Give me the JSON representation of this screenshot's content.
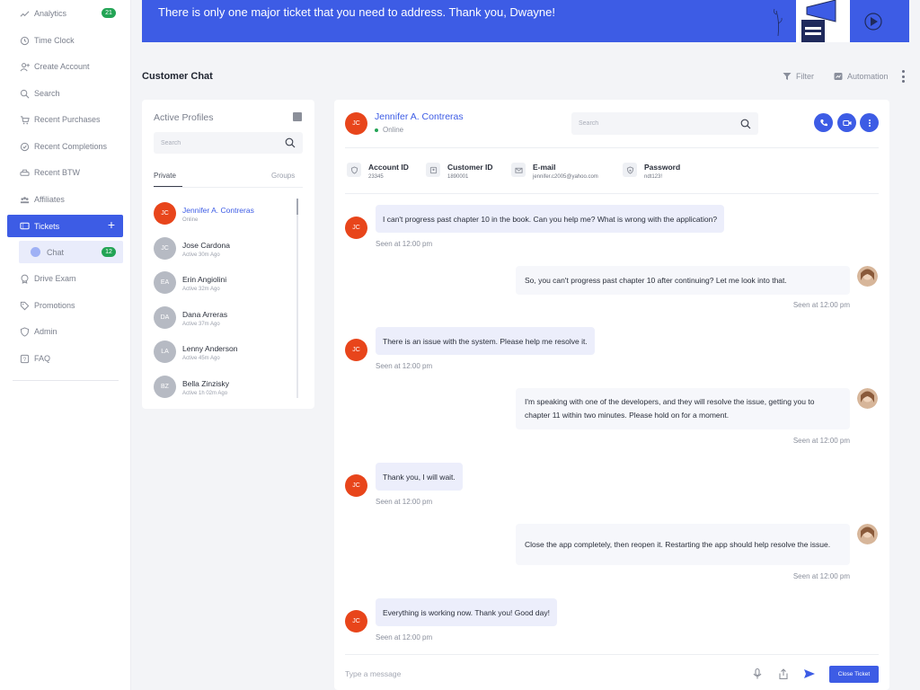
{
  "sidebar": {
    "items": [
      {
        "label": "Analytics",
        "badge": "21",
        "icon": "chart-line-icon"
      },
      {
        "label": "Time Clock",
        "icon": "clock-icon"
      },
      {
        "label": "Create Account",
        "icon": "add-user-icon"
      },
      {
        "label": "Search",
        "icon": "search-icon"
      },
      {
        "label": "Recent Purchases",
        "icon": "cart-icon"
      },
      {
        "label": "Recent Completions",
        "icon": "check-circle-icon"
      },
      {
        "label": "Recent BTW",
        "icon": "car-icon"
      },
      {
        "label": "Affiliates",
        "icon": "people-icon"
      },
      {
        "label": "Tickets",
        "icon": "ticket-icon",
        "active": true
      },
      {
        "label": "Drive Exam",
        "icon": "badge-icon"
      },
      {
        "label": "Promotions",
        "icon": "tag-icon"
      },
      {
        "label": "Admin",
        "icon": "shield-icon"
      },
      {
        "label": "FAQ",
        "icon": "question-icon"
      }
    ],
    "sub_item": {
      "label": "Chat",
      "badge": "12"
    }
  },
  "banner": {
    "text": "There is only one major ticket that you need to address. Thank you, Dwayne!"
  },
  "header": {
    "title": "Customer Chat",
    "filter_label": "Filter",
    "automation_label": "Automation"
  },
  "profiles": {
    "title": "Active Profiles",
    "search_placeholder": "Search",
    "tabs": [
      "Private",
      "Groups"
    ],
    "list": [
      {
        "initials": "JC",
        "name": "Jennifer A. Contreras",
        "status": "Online",
        "selected": true
      },
      {
        "initials": "JC",
        "name": "Jose Cardona",
        "status": "Active 30m Ago"
      },
      {
        "initials": "EA",
        "name": "Erin Angiolini",
        "status": "Active 32m Ago"
      },
      {
        "initials": "DA",
        "name": "Dana Arreras",
        "status": "Active 37m Ago"
      },
      {
        "initials": "LA",
        "name": "Lenny Anderson",
        "status": "Active 45m Ago"
      },
      {
        "initials": "BZ",
        "name": "Bella Zinzisky",
        "status": "Active 1h 02m Ago"
      }
    ]
  },
  "chat": {
    "contact": {
      "initials": "JC",
      "name": "Jennifer A. Contreras",
      "status": "Online"
    },
    "search_placeholder": "Search",
    "info": [
      {
        "label": "Account ID",
        "value": "23345"
      },
      {
        "label": "Customer ID",
        "value": "1890001"
      },
      {
        "label": "E-mail",
        "value": "jennifer.c2005@yahoo.com"
      },
      {
        "label": "Password",
        "value": "ndt123!"
      }
    ],
    "messages": [
      {
        "from": "customer",
        "text": "I can't progress past chapter 10 in the book. Can you help me? What is wrong with the application?",
        "seen": "Seen at 12:00 pm"
      },
      {
        "from": "agent",
        "text": "So, you can't progress past chapter 10 after continuing? Let me look into that.",
        "seen": "Seen at 12:00 pm"
      },
      {
        "from": "customer",
        "text": "There is an issue with the system. Please help me resolve it.",
        "seen": "Seen at 12:00 pm"
      },
      {
        "from": "agent",
        "text": "I'm speaking with one of the developers, and they will resolve the issue, getting you to chapter 11 within two minutes. Please hold on for a moment.",
        "seen": "Seen at 12:00 pm"
      },
      {
        "from": "customer",
        "text": "Thank you, I will wait.",
        "seen": "Seen at 12:00 pm"
      },
      {
        "from": "agent",
        "text": "Close the app completely, then reopen it. Restarting the app should help resolve the issue.",
        "seen": "Seen at 12:00 pm"
      },
      {
        "from": "customer",
        "text": "Everything is working now. Thank you! Good day!",
        "seen": "Seen at 12:00 pm"
      }
    ],
    "compose_placeholder": "Type a message",
    "close_ticket_label": "Close Ticket"
  },
  "colors": {
    "accent": "#3d5ce5",
    "badge_green": "#23a455",
    "avatar_orange": "#e8451b"
  }
}
